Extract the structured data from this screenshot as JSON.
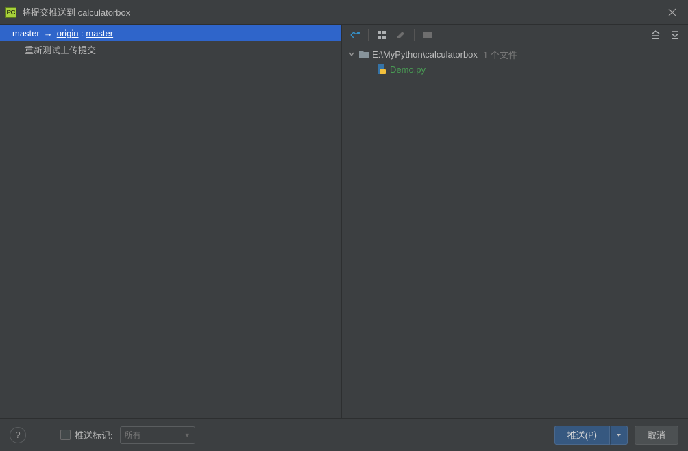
{
  "title": "将提交推送到 calculatorbox",
  "branch": {
    "local": "master",
    "arrow": "→",
    "remote": "origin",
    "sep": ":",
    "remoteBranch": "master"
  },
  "commit": "重新测试上传提交",
  "tree": {
    "rootPath": "E:\\MyPython\\calculatorbox",
    "fileCount": "1 个文件",
    "file": "Demo.py"
  },
  "footer": {
    "help": "?",
    "pushTagsLabel": "推送标记:",
    "pushTagsValue": "所有",
    "pushButton": "推送(",
    "pushMnemonic": "P",
    "pushButtonEnd": ")",
    "cancelButton": "取消"
  }
}
